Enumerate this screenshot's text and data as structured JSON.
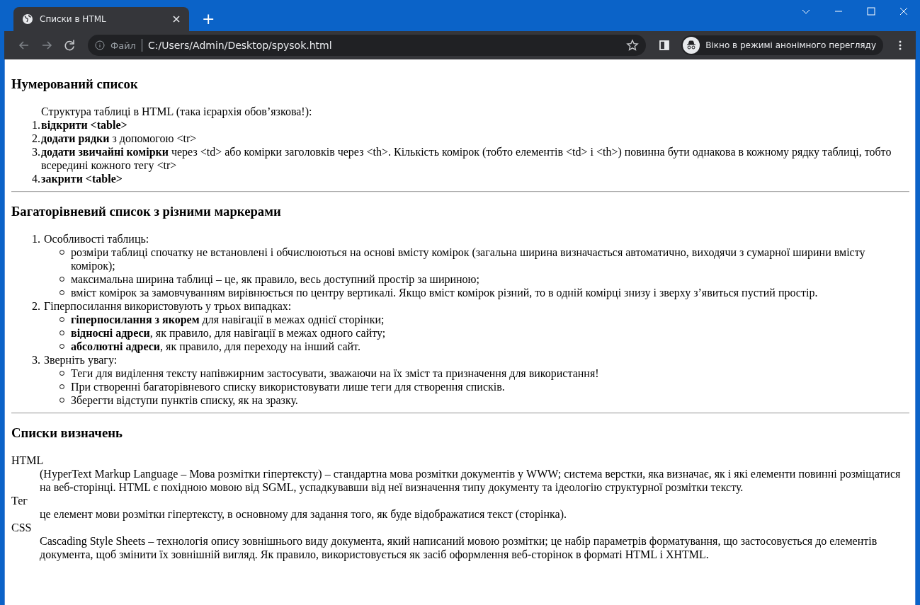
{
  "browser": {
    "tabs": [
      {
        "title": "Списки в HTML",
        "selected": true
      }
    ],
    "new_tab": "+",
    "address": {
      "security_label": "Файл",
      "url": "C:/Users/Admin/Desktop/spysok.html"
    },
    "incognito_label": "Вікно в режимі анонімного перегляду"
  },
  "sections": [
    {
      "kind": "ordered",
      "heading": "Нумерований список",
      "intro": "Структура таблиці в HTML (така ієрархія обов’язкова!):",
      "items": [
        {
          "number": "1.",
          "text": "**відкрити <table>**"
        },
        {
          "number": "2.",
          "text": "**додати рядки** з допомогою <tr>"
        },
        {
          "number": "3.",
          "text": "**додати звичайні комірки** через <td> або комірки заголовків через <th>. Кількість комірок (тобто елементів <td> і <th>) повинна бути однакова в кожному рядку таблиці, тобто всередині кожного тегу <tr>"
        },
        {
          "number": "4.",
          "text": "**закрити <table>**"
        }
      ]
    },
    {
      "kind": "nested",
      "heading": "Багаторівневий список з різними маркерами",
      "items": [
        {
          "number": "1.",
          "text": "Особливості таблиць:",
          "children": [
            {
              "text": "розміри таблиці спочатку не встановлені і обчислюються на основі вмісту комірок (загальна ширина визначається автоматично, виходячи з сумарної ширини вмісту комірок);"
            },
            {
              "text": "максимальна ширина таблиці – це, як правило, весь доступний простір за шириною;"
            },
            {
              "text": "вміст комірок за замовчуванням вирівнюється по центру вертикалі. Якщо вміст комірок різний, то в одній комірці знизу і зверху з’явиться пустий простір."
            }
          ]
        },
        {
          "number": "2.",
          "text": "Гіперпосилання використовують у трьох випадках:",
          "children": [
            {
              "text": "**гіперпосилання з якорем** для навігації в межах однієї сторінки;"
            },
            {
              "text": "**відносні адреси**, як правило, для навігації в межах одного сайту;"
            },
            {
              "text": "**абсолютні адреси**, як правило, для переходу на інший сайт."
            }
          ]
        },
        {
          "number": "3.",
          "text": "Зверніть увагу:",
          "children": [
            {
              "text": "Теги для виділення тексту напівжирним застосувати, зважаючи на їх зміст та призначення для використання!"
            },
            {
              "text": "При створенні багаторівневого списку використовувати лише теги для створення списків."
            },
            {
              "text": "Зберегти відступи пунктів списку, як на зразку."
            }
          ]
        }
      ]
    },
    {
      "kind": "definitions",
      "heading": "Списки визначень",
      "entries": [
        {
          "term": "HTML",
          "definition": "(HyperText Markup Language – Мова розмітки гіпертексту) – стандартна мова розмітки документів у WWW; система верстки, яка визначає, як і які елементи повинні розміщатися на веб-сторінці. HTML є похідною мовою від SGML, успадкувавши від неї визначення типу документу та ідеологію структурної розмітки тексту."
        },
        {
          "term": "Тег",
          "definition": "це елемент мови розмітки гіпертексту, в основному для задання того, як буде відображатися текст (сторінка)."
        },
        {
          "term": "CSS",
          "definition": "Cascading Style Sheets – технологія опису зовнішнього виду документа, який написаний мовою розмітки; це набір параметрів форматування, що застосовується до елементів документа, щоб змінити їх зовнішній вигляд. Як правило, використовується як засіб оформлення веб-сторінок в форматі HTML і XHTML."
        }
      ]
    }
  ]
}
